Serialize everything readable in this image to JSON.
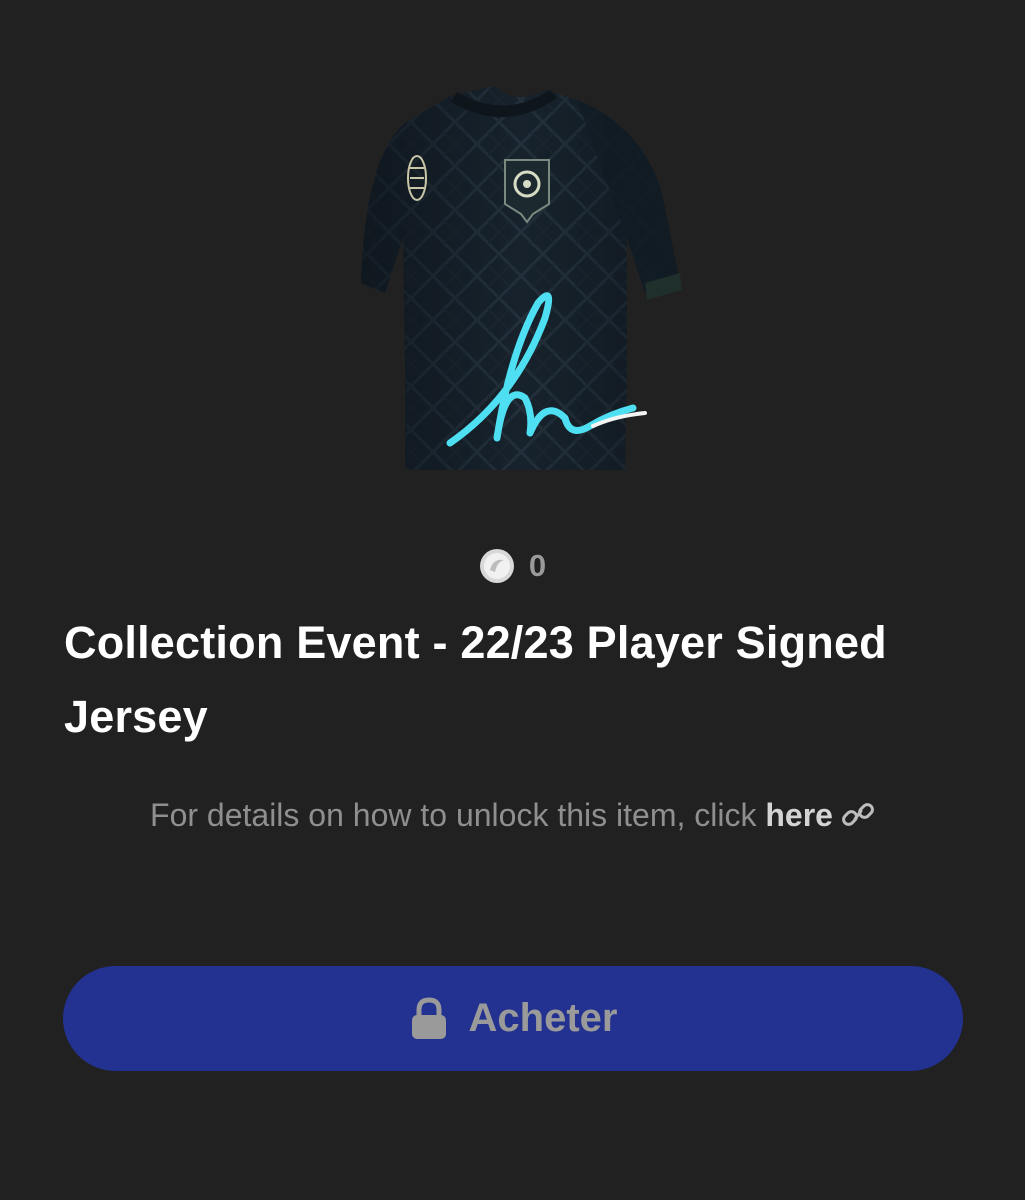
{
  "product": {
    "image_alt": "Signed black jersey",
    "price": "0",
    "coin_icon": "coin-icon",
    "title": "Collection Event - 22/23 Player Signed Jersey"
  },
  "details": {
    "text": "For details on how to unlock this item, click ",
    "link_label": "here",
    "link_icon": "link-icon"
  },
  "actions": {
    "buy_label": "Acheter",
    "buy_icon": "lock-icon",
    "buy_color": "#233190"
  },
  "colors": {
    "background": "#212121",
    "signature": "#4ee0f2"
  }
}
